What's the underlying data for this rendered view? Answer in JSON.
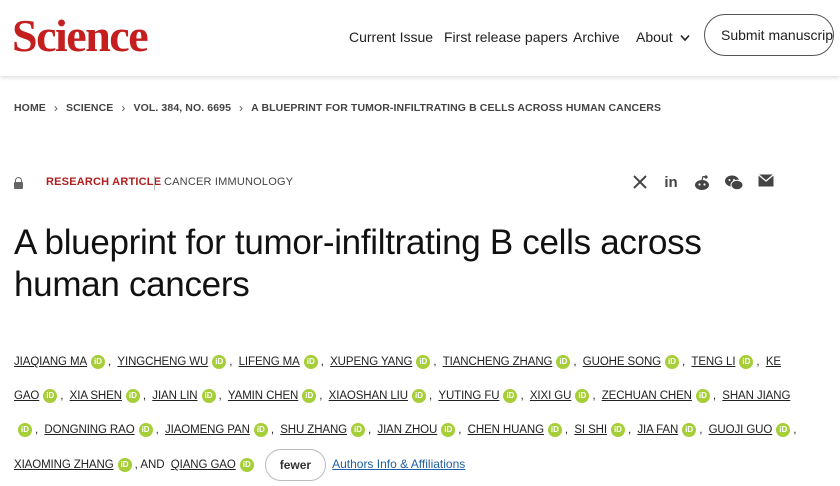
{
  "header": {
    "logo": "Science",
    "nav": {
      "current_issue": "Current Issue",
      "first_release": "First release papers",
      "archive": "Archive",
      "about": "About",
      "about_chevron": "chevron-down-icon"
    },
    "submit_label": "Submit manuscript"
  },
  "breadcrumb": {
    "home": "HOME",
    "science": "SCIENCE",
    "volume": "VOL. 384, NO. 6695",
    "article": "A BLUEPRINT FOR TUMOR-INFILTRATING B CELLS ACROSS HUMAN CANCERS",
    "separator": "›"
  },
  "meta": {
    "access_icon": "lock-icon",
    "article_type": "RESEARCH ARTICLE",
    "subject": "CANCER IMMUNOLOGY"
  },
  "share": {
    "x": "𝕏",
    "linkedin": "in",
    "reddit": "●",
    "wechat": "☁",
    "email": "✉"
  },
  "title": "A blueprint for tumor-infiltrating B cells across human cancers",
  "colors": {
    "brand": "#c41e1e",
    "article_type": "#b01e1e",
    "orcid": "#a6ce39",
    "link": "#1f5fa8"
  },
  "authors": {
    "orcid_glyph": "iD",
    "list": [
      "JIAQIANG MA",
      "YINGCHENG WU",
      "LIFENG MA",
      "XUPENG YANG",
      "TIANCHENG ZHANG",
      "GUOHE SONG",
      "TENG LI",
      "KE GAO",
      "XIA SHEN",
      "JIAN LIN",
      "YAMIN CHEN",
      "XIAOSHAN LIU",
      "YUTING FU",
      "XIXI GU",
      "ZECHUAN CHEN",
      "SHAN JIANG",
      "DONGNING RAO",
      "JIAOMENG PAN",
      "SHU ZHANG",
      "JIAN ZHOU",
      "CHEN HUANG",
      "SI SHI",
      "JIA FAN",
      "GUOJI GUO",
      "XIAOMING ZHANG",
      "QIANG GAO"
    ],
    "comma": ",",
    "and_text": ", AND",
    "fewer_label": "fewer",
    "info_link": "Authors Info & Affiliations"
  }
}
